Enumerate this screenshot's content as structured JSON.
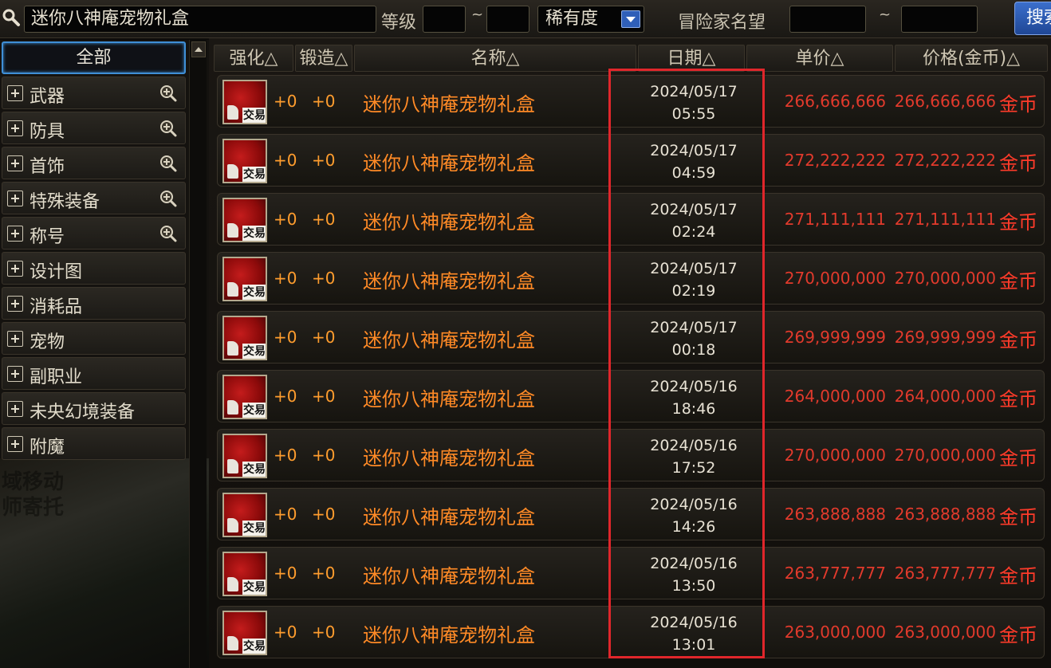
{
  "search": {
    "query": "迷你八神庵宠物礼盒",
    "level_label": "等级",
    "level_min": "",
    "level_max": "",
    "range_sep": "~",
    "rarity_label": "稀有度",
    "reputation_label": "冒险家名望",
    "reputation_min": "",
    "reputation_max": "",
    "search_button": "搜索"
  },
  "sidebar": {
    "items": [
      {
        "label": "全部",
        "selected": true,
        "expandable": false,
        "zoom": false
      },
      {
        "label": "武器",
        "expandable": true,
        "zoom": true,
        "icon": "zoom-in-icon"
      },
      {
        "label": "防具",
        "expandable": true,
        "zoom": true,
        "icon": "zoom-in-icon"
      },
      {
        "label": "首饰",
        "expandable": true,
        "zoom": true,
        "icon": "zoom-in-icon"
      },
      {
        "label": "特殊装备",
        "expandable": true,
        "zoom": true,
        "icon": "zoom-in-icon"
      },
      {
        "label": "称号",
        "expandable": true,
        "zoom": true,
        "icon": "zoom-in-icon"
      },
      {
        "label": "设计图",
        "expandable": true,
        "zoom": false
      },
      {
        "label": "消耗品",
        "expandable": true,
        "zoom": false
      },
      {
        "label": "宠物",
        "expandable": true,
        "zoom": false
      },
      {
        "label": "副职业",
        "expandable": true,
        "zoom": false
      },
      {
        "label": "未央幻境装备",
        "expandable": true,
        "zoom": false
      },
      {
        "label": "附魔",
        "expandable": true,
        "zoom": false
      }
    ],
    "background_text_1": "域移动",
    "background_text_2": "师寄托"
  },
  "table": {
    "headers": [
      "强化△",
      "锻造△",
      "名称△",
      "日期△",
      "单价△",
      "价格(金币)△"
    ],
    "rows": [
      {
        "enhance": "+0",
        "forge": "+0",
        "name": "迷你八神庵宠物礼盒",
        "date": "2024/05/17",
        "time": "05:55",
        "unit_price": "266,666,666",
        "price": "266,666,666",
        "currency": "金币"
      },
      {
        "enhance": "+0",
        "forge": "+0",
        "name": "迷你八神庵宠物礼盒",
        "date": "2024/05/17",
        "time": "04:59",
        "unit_price": "272,222,222",
        "price": "272,222,222",
        "currency": "金币"
      },
      {
        "enhance": "+0",
        "forge": "+0",
        "name": "迷你八神庵宠物礼盒",
        "date": "2024/05/17",
        "time": "02:24",
        "unit_price": "271,111,111",
        "price": "271,111,111",
        "currency": "金币"
      },
      {
        "enhance": "+0",
        "forge": "+0",
        "name": "迷你八神庵宠物礼盒",
        "date": "2024/05/17",
        "time": "02:19",
        "unit_price": "270,000,000",
        "price": "270,000,000",
        "currency": "金币"
      },
      {
        "enhance": "+0",
        "forge": "+0",
        "name": "迷你八神庵宠物礼盒",
        "date": "2024/05/17",
        "time": "00:18",
        "unit_price": "269,999,999",
        "price": "269,999,999",
        "currency": "金币"
      },
      {
        "enhance": "+0",
        "forge": "+0",
        "name": "迷你八神庵宠物礼盒",
        "date": "2024/05/16",
        "time": "18:46",
        "unit_price": "264,000,000",
        "price": "264,000,000",
        "currency": "金币"
      },
      {
        "enhance": "+0",
        "forge": "+0",
        "name": "迷你八神庵宠物礼盒",
        "date": "2024/05/16",
        "time": "17:52",
        "unit_price": "270,000,000",
        "price": "270,000,000",
        "currency": "金币"
      },
      {
        "enhance": "+0",
        "forge": "+0",
        "name": "迷你八神庵宠物礼盒",
        "date": "2024/05/16",
        "time": "14:26",
        "unit_price": "263,888,888",
        "price": "263,888,888",
        "currency": "金币"
      },
      {
        "enhance": "+0",
        "forge": "+0",
        "name": "迷你八神庵宠物礼盒",
        "date": "2024/05/16",
        "time": "13:50",
        "unit_price": "263,777,777",
        "price": "263,777,777",
        "currency": "金币"
      },
      {
        "enhance": "+0",
        "forge": "+0",
        "name": "迷你八神庵宠物礼盒",
        "date": "2024/05/16",
        "time": "13:01",
        "unit_price": "263,000,000",
        "price": "263,000,000",
        "currency": "金币"
      }
    ],
    "item_icon": "red-cap-item-icon",
    "item_tag": "交易"
  },
  "colors": {
    "highlight_border": "#e0262b",
    "price_red": "#e23a2c",
    "name_orange": "#ff8a26",
    "select_blue": "#2f5fb8"
  }
}
